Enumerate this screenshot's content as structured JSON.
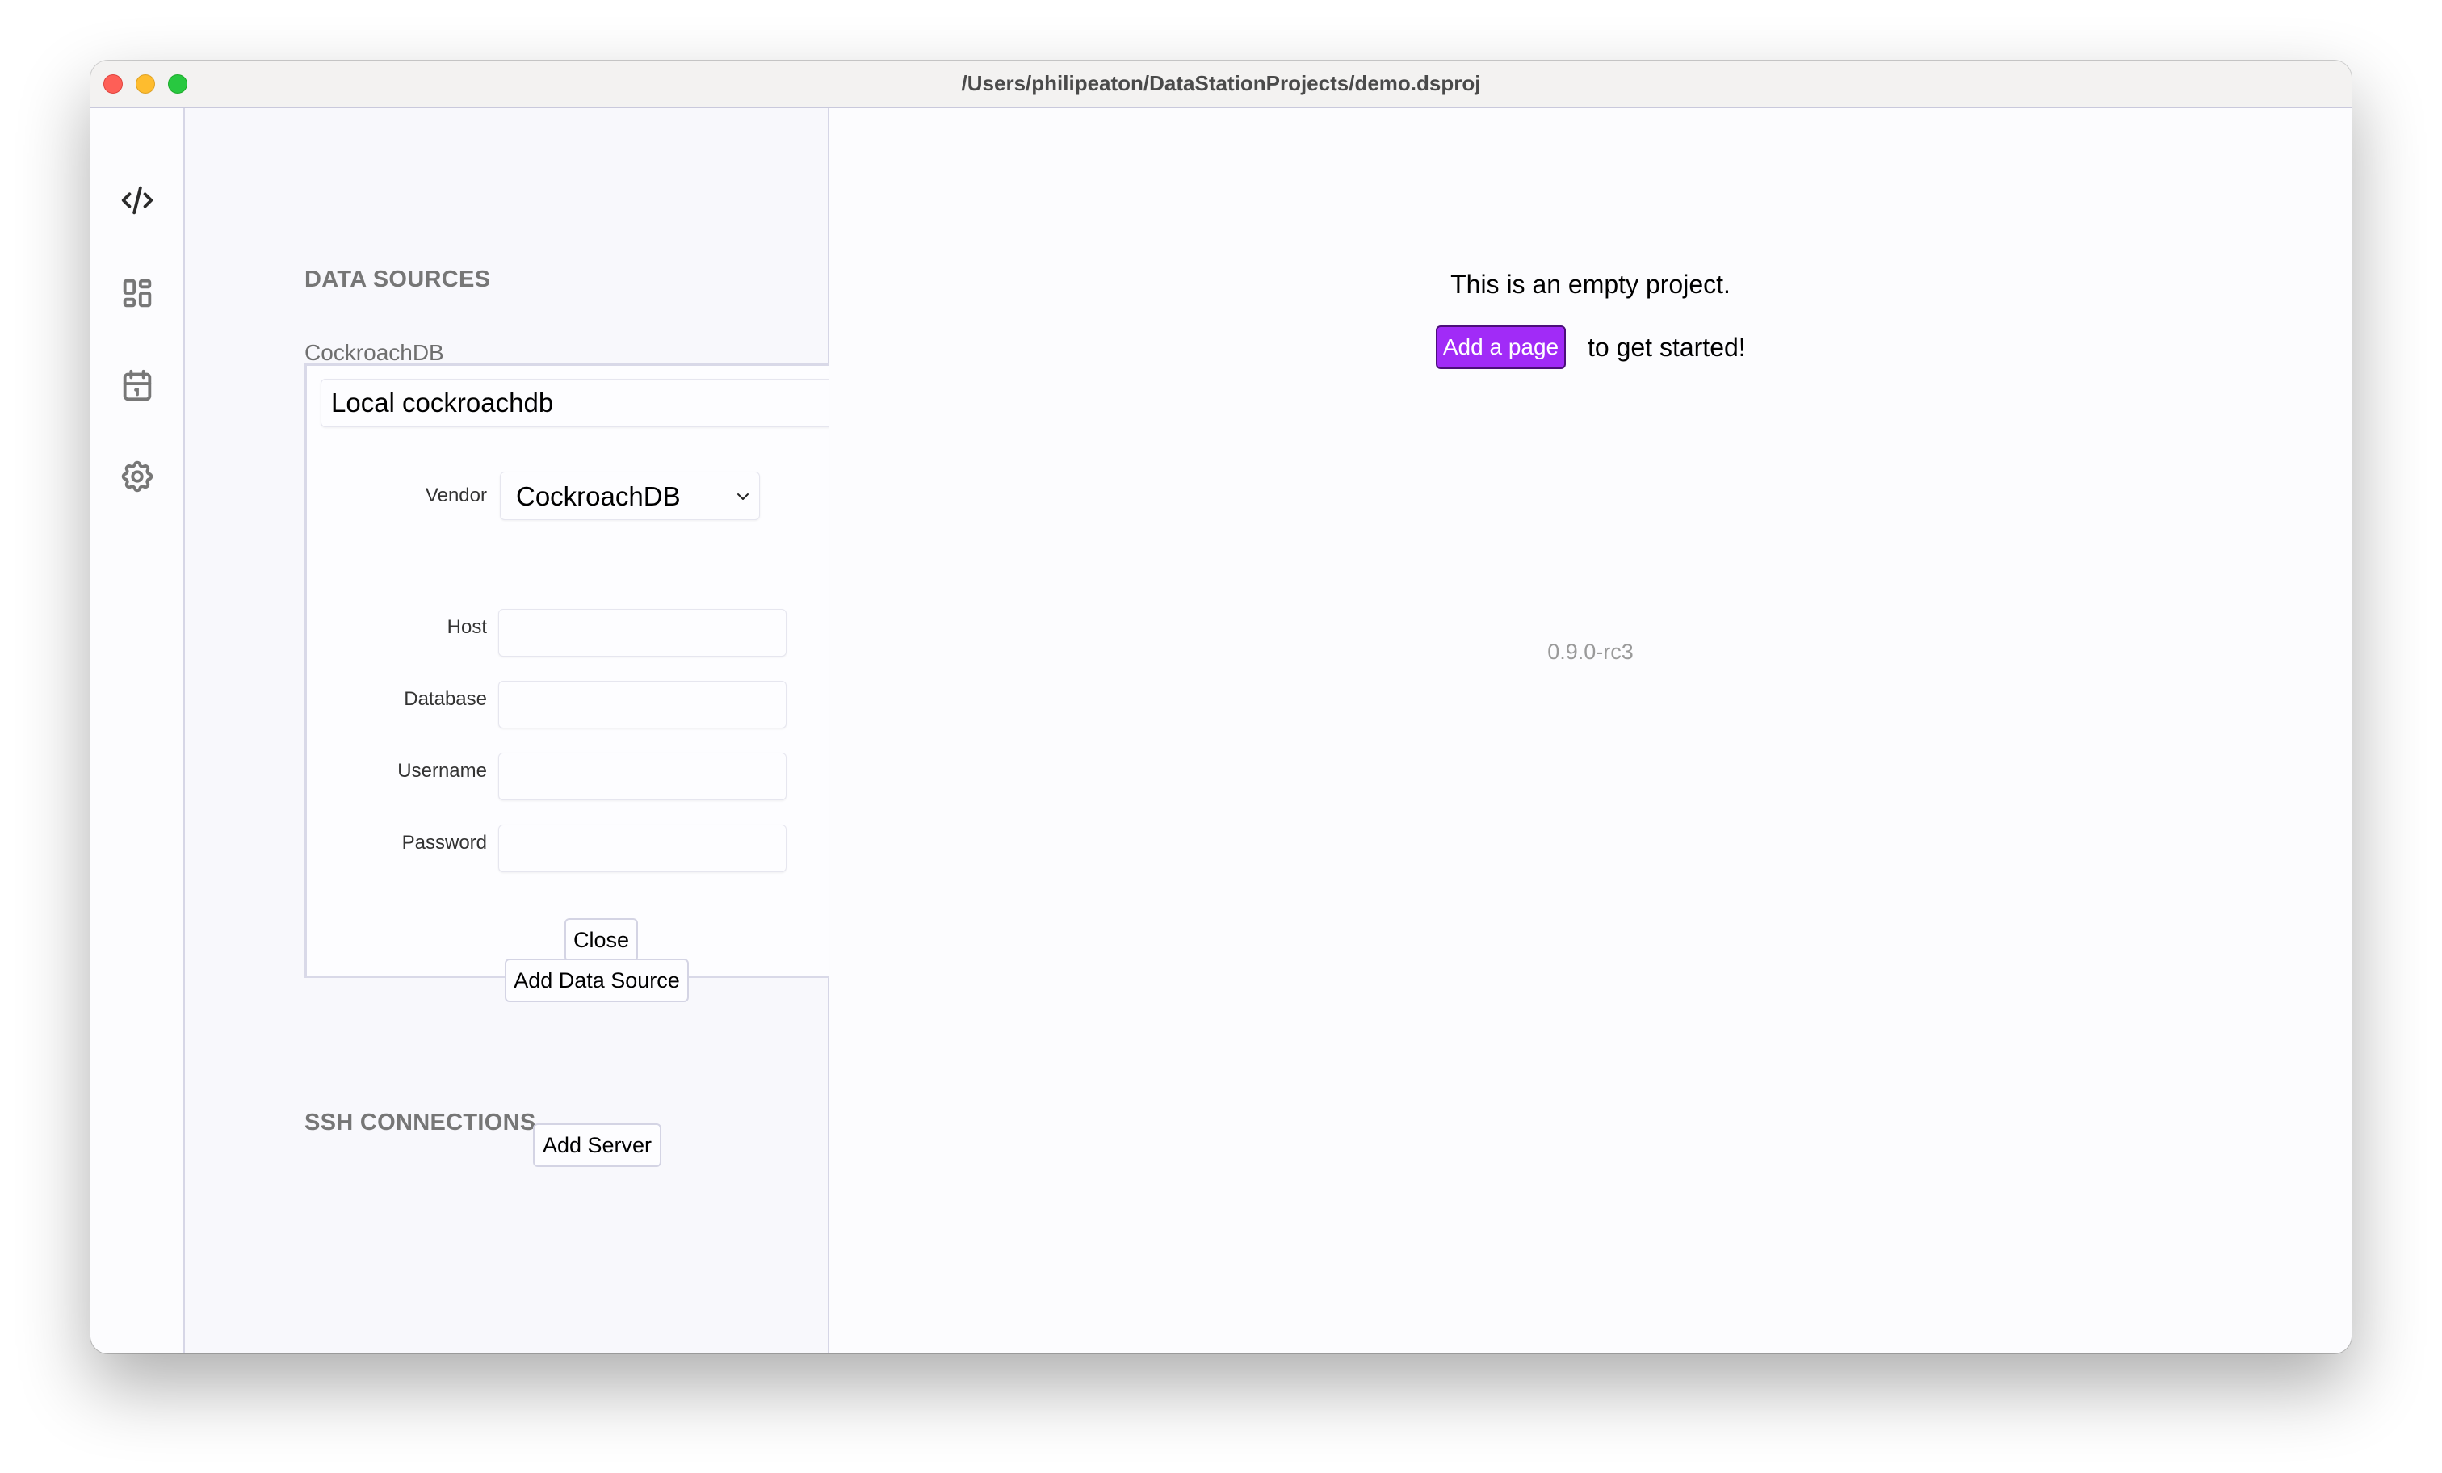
{
  "window": {
    "title": "/Users/philipeaton/DataStationProjects/demo.dsproj",
    "traffic_lights": [
      "close",
      "minimize",
      "maximize"
    ]
  },
  "rail": {
    "items": [
      {
        "icon": "code-icon",
        "label": "Editor",
        "active": true
      },
      {
        "icon": "dashboard-icon",
        "label": "Dashboard",
        "active": false
      },
      {
        "icon": "calendar-icon",
        "label": "Scheduler",
        "active": false
      },
      {
        "icon": "gear-icon",
        "label": "Settings",
        "active": false
      }
    ]
  },
  "panel": {
    "collapse_icon": "chevron-left-icon",
    "data_sources_title": "DATA SOURCES",
    "data_source": {
      "type_label": "CockroachDB",
      "name": "Local cockroachdb",
      "vendor_label": "Vendor",
      "vendor_value": "CockroachDB",
      "fields": [
        {
          "label": "Host",
          "value": ""
        },
        {
          "label": "Database",
          "value": ""
        },
        {
          "label": "Username",
          "value": ""
        },
        {
          "label": "Password",
          "value": ""
        }
      ],
      "close_label": "Close"
    },
    "add_data_source_label": "Add Data Source",
    "ssh_title": "SSH CONNECTIONS",
    "add_server_label": "Add Server"
  },
  "main": {
    "empty_message": "This is an empty project.",
    "add_page_label": "Add a page",
    "get_started_suffix": "to get started!",
    "version": "0.9.0-rc3"
  },
  "colors": {
    "accent": "#a12bf7",
    "accent_border": "#4c0f7a",
    "section_title": "#767676",
    "border": "#d6d6e6"
  }
}
